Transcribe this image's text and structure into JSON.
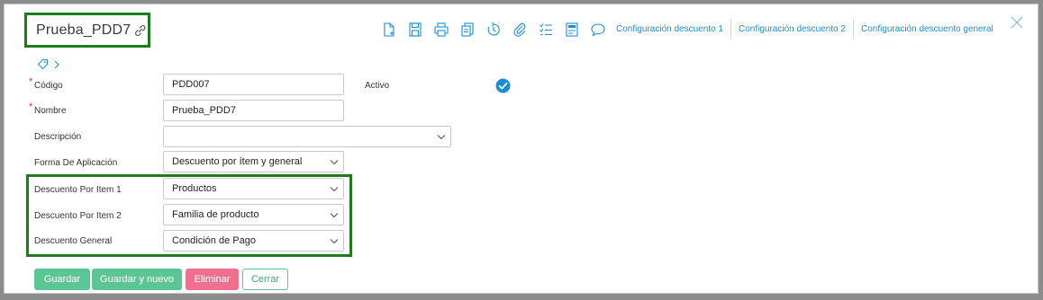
{
  "header": {
    "title": "Prueba_PDD7",
    "config_links": [
      "Configuración descuento 1",
      "Configuración descuento 2",
      "Configuración descuento general"
    ]
  },
  "toolbar_icons": [
    "new-document-icon",
    "save-icon",
    "print-icon",
    "copy-icon",
    "history-icon",
    "attachment-icon",
    "checklist-icon",
    "report-icon",
    "comment-icon"
  ],
  "form": {
    "codigo": {
      "label": "Código",
      "value": "PDD007",
      "required": true
    },
    "activo": {
      "label": "Activo",
      "checked": true
    },
    "nombre": {
      "label": "Nombre",
      "value": "Prueba_PDD7",
      "required": true
    },
    "descripcion": {
      "label": "Descripción",
      "value": ""
    },
    "forma_aplicacion": {
      "label": "Forma De Aplicación",
      "value": "Descuento por ítem y general"
    },
    "descuento_item_1": {
      "label": "Descuento Por Item 1",
      "value": "Productos"
    },
    "descuento_item_2": {
      "label": "Descuento Por Item 2",
      "value": "Familia de producto"
    },
    "descuento_general": {
      "label": "Descuento General",
      "value": "Condición de Pago"
    }
  },
  "buttons": {
    "guardar": "Guardar",
    "guardar_nuevo": "Guardar y nuevo",
    "eliminar": "Eliminar",
    "cerrar": "Cerrar"
  },
  "colors": {
    "accent_blue": "#1a8ed4",
    "highlight_green": "#1e7a1e",
    "button_green": "#5cc595",
    "button_pink": "#f06f8f",
    "required_red": "#e03030"
  }
}
